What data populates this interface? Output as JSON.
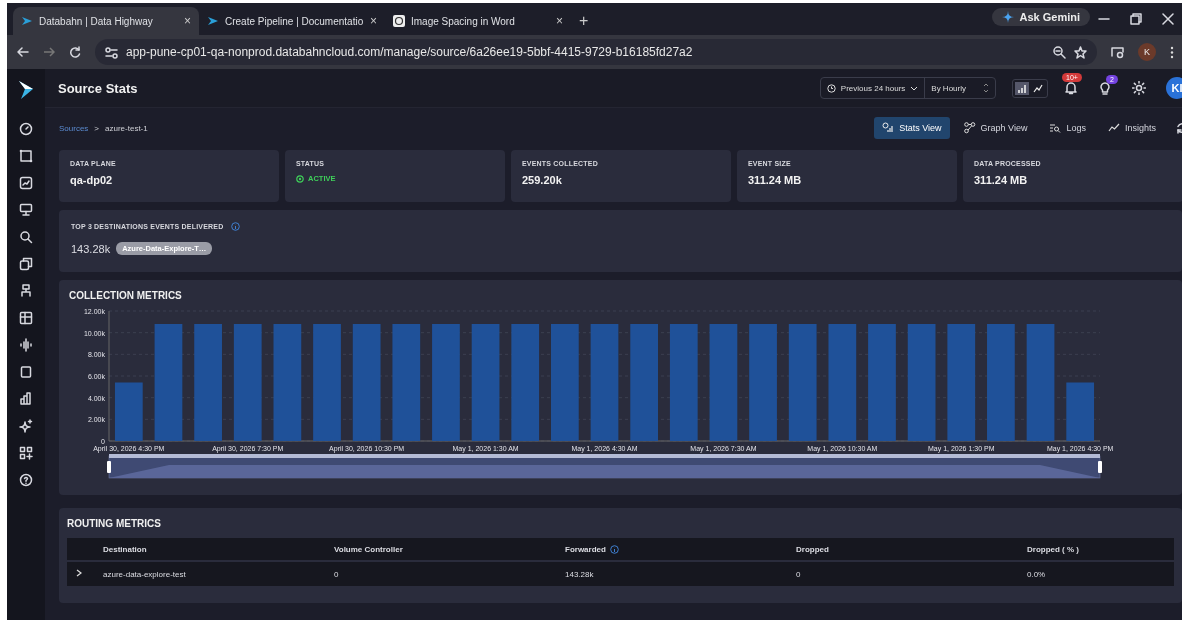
{
  "browser": {
    "tabs": [
      {
        "title": "Databahn | Data Highway",
        "close": "×",
        "selected": true
      },
      {
        "title": "Create Pipeline | Documentatio",
        "close": "×",
        "selected": false
      },
      {
        "title": "Image Spacing in Word",
        "close": "×",
        "selected": false
      }
    ],
    "new_tab": "+",
    "ask_button": "Ask Gemini",
    "url": "app-pune-cp01-qa-nonprod.databahncloud.com/manage/source/6a26ee19-5bbf-4415-9729-b16185fd27a2",
    "profile": "K"
  },
  "header": {
    "title": "Source Stats",
    "time_range": "Previous 24 hours",
    "interval": "By Hourly",
    "chart_toggle": [
      {
        "kind": "bar",
        "selected": true
      },
      {
        "kind": "line",
        "selected": false
      }
    ],
    "notification_badge": "10+",
    "tips_badge": "2",
    "avatar": "KI"
  },
  "breadcrumb": {
    "parent": "Sources",
    "separator": ">",
    "current": "azure-test-1"
  },
  "views": [
    {
      "label": "Stats View",
      "selected": true
    },
    {
      "label": "Graph View",
      "selected": false
    },
    {
      "label": "Logs",
      "selected": false
    },
    {
      "label": "Insights",
      "selected": false
    }
  ],
  "stats": [
    {
      "label": "DATA PLANE",
      "value": "qa-dp02",
      "kind": "text"
    },
    {
      "label": "STATUS",
      "value": "ACTIVE",
      "kind": "status"
    },
    {
      "label": "EVENTS COLLECTED",
      "value": "259.20k",
      "kind": "text"
    },
    {
      "label": "EVENT SIZE",
      "value": "311.24 MB",
      "kind": "text"
    },
    {
      "label": "DATA PROCESSED",
      "value": "311.24 MB",
      "kind": "text"
    }
  ],
  "top_destinations": {
    "title": "TOP 3 DESTINATIONS EVENTS DELIVERED",
    "count": "143.28k",
    "tags": [
      "Azure-Data-Explore-T…"
    ]
  },
  "collection_metrics": {
    "title": "COLLECTION METRICS",
    "chart_data": {
      "type": "bar",
      "grid": true,
      "categories": [
        "April 30, 2026 4:30 PM",
        null,
        null,
        "April 30, 2026 7:30 PM",
        null,
        null,
        "April 30, 2026 10:30 PM",
        null,
        null,
        "May 1, 2026 1:30 AM",
        null,
        null,
        "May 1, 2026 4:30 AM",
        null,
        null,
        "May 1, 2026 7:30 AM",
        null,
        null,
        "May 1, 2026 10:30 AM",
        null,
        null,
        "May 1, 2026 1:30 PM",
        null,
        null,
        "May 1, 2026 4:30 PM"
      ],
      "series": [
        {
          "color": "#1f5199",
          "values": [
            5400,
            10800,
            10800,
            10800,
            10800,
            10800,
            10800,
            10800,
            10800,
            10800,
            10800,
            10800,
            10800,
            10800,
            10800,
            10800,
            10800,
            10800,
            10800,
            10800,
            10800,
            10800,
            10800,
            10800,
            5400
          ]
        }
      ],
      "ylim": [
        0,
        12000
      ],
      "yticks": [
        {
          "value": 0,
          "label": "0"
        },
        {
          "value": 2000,
          "label": "2.00k"
        },
        {
          "value": 4000,
          "label": "4.00k"
        },
        {
          "value": 6000,
          "label": "6.00k"
        },
        {
          "value": 8000,
          "label": "8.00k"
        },
        {
          "value": 10000,
          "label": "10.00k"
        },
        {
          "value": 12000,
          "label": "12.00k"
        }
      ]
    }
  },
  "routing_metrics": {
    "title": "ROUTING METRICS",
    "columns": [
      "Destination",
      "Volume Controller",
      "Forwarded",
      "Dropped",
      "Dropped ( % )"
    ],
    "rows": [
      {
        "expanded": false,
        "cells": [
          "azure-data-explore-test",
          "0",
          "143.28k",
          "0",
          "0.0%"
        ]
      }
    ]
  }
}
